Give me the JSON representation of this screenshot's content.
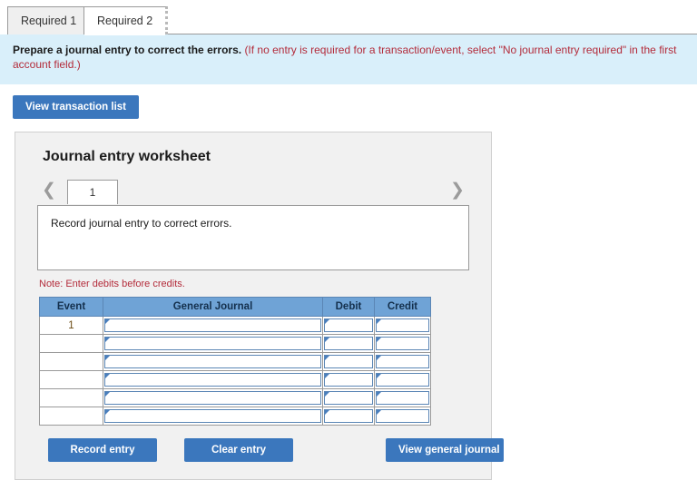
{
  "tabs": [
    {
      "label": "Required 1",
      "active": false
    },
    {
      "label": "Required 2",
      "active": true
    }
  ],
  "banner": {
    "lead": "Prepare a journal entry to correct the errors.",
    "note": "(If no entry is required for a transaction/event, select \"No journal entry required\" in the first account field.)"
  },
  "toolbar": {
    "view_transaction_list_label": "View transaction list"
  },
  "worksheet": {
    "title": "Journal entry worksheet",
    "pager": {
      "prev_icon": "chevron-left-icon",
      "next_icon": "chevron-right-icon",
      "current_page": "1"
    },
    "description": "Record journal entry to correct errors.",
    "hint": "Note: Enter debits before credits.",
    "table": {
      "headers": [
        "Event",
        "General Journal",
        "Debit",
        "Credit"
      ],
      "rows": [
        {
          "event": "1",
          "general_journal": "",
          "debit": "",
          "credit": ""
        },
        {
          "event": "",
          "general_journal": "",
          "debit": "",
          "credit": ""
        },
        {
          "event": "",
          "general_journal": "",
          "debit": "",
          "credit": ""
        },
        {
          "event": "",
          "general_journal": "",
          "debit": "",
          "credit": ""
        },
        {
          "event": "",
          "general_journal": "",
          "debit": "",
          "credit": ""
        },
        {
          "event": "",
          "general_journal": "",
          "debit": "",
          "credit": ""
        }
      ]
    },
    "actions": {
      "record_entry_label": "Record entry",
      "clear_entry_label": "Clear entry",
      "view_general_journal_label": "View general journal"
    }
  },
  "colors": {
    "button_blue": "#3b77bd",
    "header_blue": "#6fa3d6",
    "banner_blue": "#d9effa",
    "panel_grey": "#f1f1f1",
    "note_red": "#b32b3a"
  }
}
